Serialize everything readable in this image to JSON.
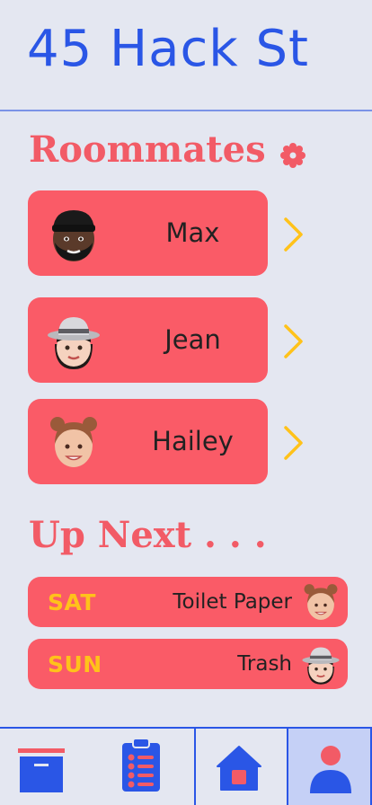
{
  "header": {
    "title": "45 Hack St"
  },
  "roommates": {
    "title": "Roommates",
    "items": [
      {
        "name": "Max",
        "avatar": "man-beanie-avatar"
      },
      {
        "name": "Jean",
        "avatar": "woman-hat-avatar"
      },
      {
        "name": "Hailey",
        "avatar": "woman-buns-avatar"
      }
    ]
  },
  "up_next": {
    "title": "Up Next . . .",
    "items": [
      {
        "day": "SAT",
        "task": "Toilet Paper",
        "avatar": "woman-buns-avatar"
      },
      {
        "day": "SUN",
        "task": "Trash",
        "avatar": "woman-hat-avatar"
      }
    ]
  },
  "bottom_nav": {
    "items": [
      {
        "icon": "calendar-icon",
        "active": false
      },
      {
        "icon": "clipboard-list-icon",
        "active": false
      },
      {
        "icon": "home-icon",
        "active": false
      },
      {
        "icon": "profile-icon",
        "active": true
      }
    ]
  },
  "colors": {
    "background": "#e4e7f1",
    "primary_blue": "#2a56e6",
    "coral": "#fa5b67",
    "accent_yellow": "#ffc21a",
    "active_tab": "#c5d0f6"
  }
}
